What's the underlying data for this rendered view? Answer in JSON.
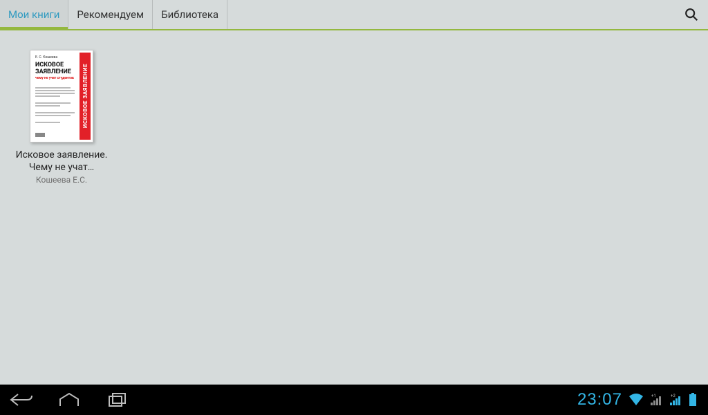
{
  "tabs": [
    {
      "label": "Мои книги",
      "active": true
    },
    {
      "label": "Рекомендуем",
      "active": false
    },
    {
      "label": "Библиотека",
      "active": false
    }
  ],
  "icons": {
    "search": "search-icon"
  },
  "books": [
    {
      "title": "Исковое заявление. Чему не учат…",
      "author": "Кошеева Е.С.",
      "cover": {
        "line1": "ИСКОВОЕ",
        "line2": "ЗАЯВЛЕНИЕ",
        "sub": "чему не учат студентов",
        "spine": "ИСКОВОЕ ЗАЯВЛЕНИЕ",
        "top_author": "Е. С. Кошеева"
      }
    }
  ],
  "statusbar": {
    "time": "23:07"
  },
  "colors": {
    "accent_green": "#94b83f",
    "tab_active_text": "#2f9ac0",
    "status_cyan": "#33b5e5",
    "cover_red": "#e22028"
  }
}
